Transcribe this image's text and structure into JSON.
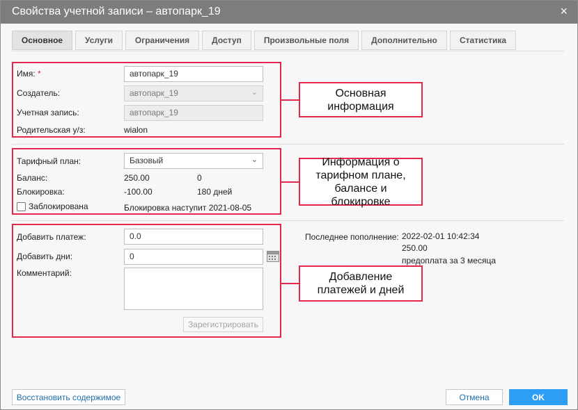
{
  "window": {
    "title": "Свойства учетной записи – автопарк_19",
    "close_symbol": "×"
  },
  "tabs": [
    {
      "label": "Основное",
      "active": true
    },
    {
      "label": "Услуги"
    },
    {
      "label": "Ограничения"
    },
    {
      "label": "Доступ"
    },
    {
      "label": "Произвольные поля"
    },
    {
      "label": "Дополнительно"
    },
    {
      "label": "Статистика"
    }
  ],
  "basic": {
    "name_label": "Имя:",
    "required_mark": "*",
    "name_value": "автопарк_19",
    "creator_label": "Создатель:",
    "creator_value": "автопарк_19",
    "account_label": "Учетная запись:",
    "account_value": "автопарк_19",
    "parent_label": "Родительская у/з:",
    "parent_value": "wialon"
  },
  "billing": {
    "plan_label": "Тарифный план:",
    "plan_value": "Базовый",
    "balance_label": "Баланс:",
    "balance_value": "250.00",
    "balance_days": "0",
    "block_label": "Блокировка:",
    "block_value": "-100.00",
    "block_days": "180 дней",
    "blocked_checkbox_label": "Заблокирована",
    "blocked_checked": false,
    "block_note": "Блокировка наступит 2021-08-05"
  },
  "payment": {
    "add_payment_label": "Добавить платеж:",
    "add_payment_value": "0.0",
    "add_days_label": "Добавить дни:",
    "add_days_value": "0",
    "comment_label": "Комментарий:",
    "register_button": "Зарегистрировать",
    "last_topup_label": "Последнее пополнение:",
    "last_topup_date": "2022-02-01 10:42:34",
    "last_topup_amount": "250.00",
    "last_topup_comment": "предоплата за 3 месяца"
  },
  "annotations": {
    "basic_info": "Основная информация",
    "billing_info": "Информация о тарифном плане, балансе и блокировке",
    "payments_info": "Добавление платежей и дней",
    "color": "#e3264c"
  },
  "footer": {
    "restore_button": "Восстановить содержимое",
    "cancel_button": "Отмена",
    "ok_button": "OK"
  },
  "colors": {
    "titlebar": "#7d7d7d",
    "primary_button": "#2c9ef3",
    "link": "#1f6dab"
  },
  "icons": {
    "close": "close-icon",
    "dropdown": "chevron-down-icon",
    "calendar": "calendar-icon"
  }
}
